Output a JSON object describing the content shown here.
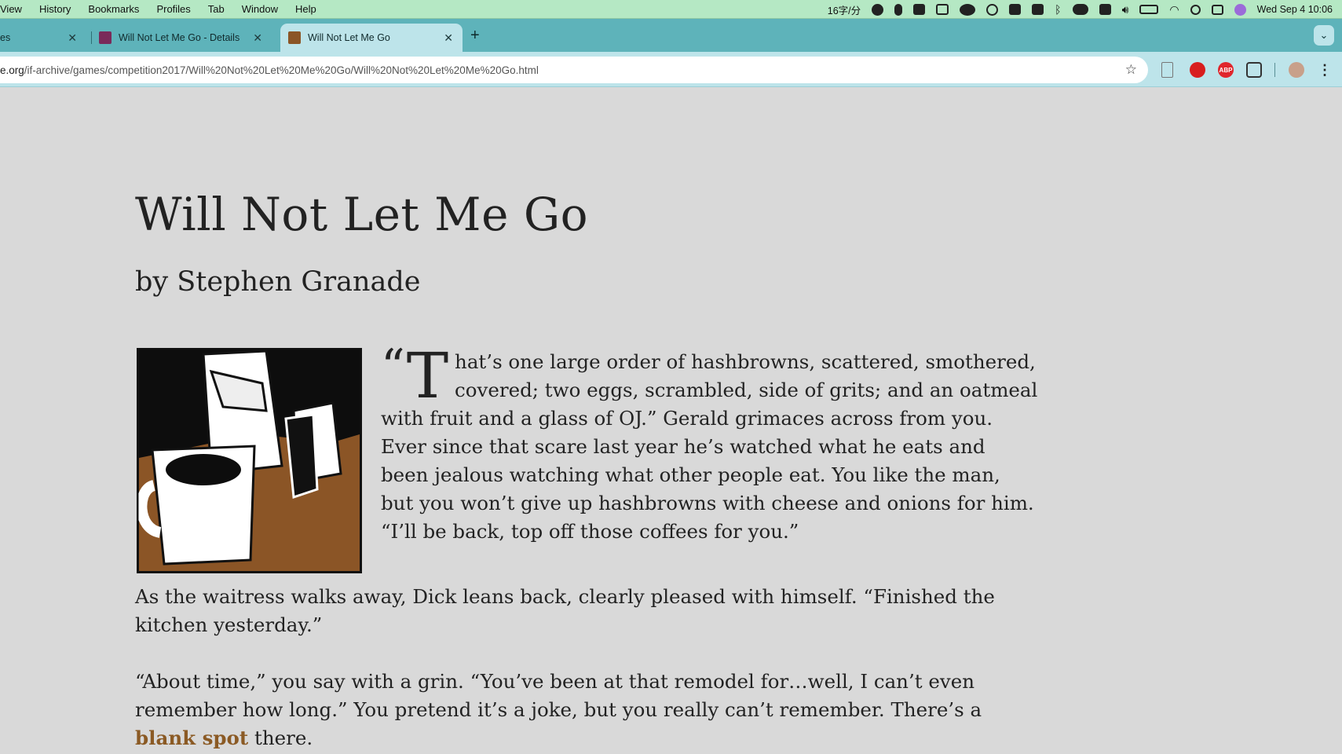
{
  "menubar": {
    "items": [
      "View",
      "History",
      "Bookmarks",
      "Profiles",
      "Tab",
      "Window",
      "Help"
    ],
    "status": {
      "reading_speed": "16字/分",
      "datetime": "Wed Sep 4  10:06"
    }
  },
  "tabs": [
    {
      "label": "es",
      "active": false
    },
    {
      "label": "Will Not Let Me Go - Details",
      "active": false
    },
    {
      "label": "Will Not Let Me Go",
      "active": true
    }
  ],
  "tab_close_glyph": "✕",
  "new_tab_glyph": "+",
  "tab_menu_glyph": "⌄",
  "address": {
    "url_prefix": "e.org",
    "url_path": "/if-archive/games/competition2017/Will%20Not%20Let%20Me%20Go/Will%20Not%20Let%20Me%20Go.html"
  },
  "bookmark_glyph": "☆",
  "extensions": {
    "abp_label": "ABP",
    "menu_glyph": "⋮"
  },
  "article": {
    "title": "Will Not Let Me Go",
    "byline": "by Stephen Granade",
    "p1_quote": "“",
    "p1_dropcap": "T",
    "p1_text": "hat’s one large order of hashbrowns, scattered, smothered, covered; two eggs, scrambled, side of grits; and an oatmeal with fruit and a glass of OJ.” Gerald grimaces across from you. Ever since that scare last year he’s watched what he eats and been jealous watching what other people eat. You like the man, but you won’t give up hashbrowns with cheese and onions for him. “I’ll be back, top off those coffees for you.”",
    "p2_text": "As the waitress walks away, Dick leans back, clearly pleased with himself. “Finished the kitchen yesterday.”",
    "p3_text_before": "“About time,” you say with a grin. “You’ve been at that remodel for…well, I can’t even remember how long.” You pretend it’s a joke, but you really can’t remember. There’s a ",
    "p3_link": "blank spot",
    "p3_text_after": " there."
  },
  "colors": {
    "menubar": "#b5e8c4",
    "tabstrip": "#5eb3ba",
    "toolbar": "#bde4ea",
    "page_bg": "#d9d9d9",
    "link": "#8b5a24",
    "illustration_brown": "#8b5526"
  }
}
